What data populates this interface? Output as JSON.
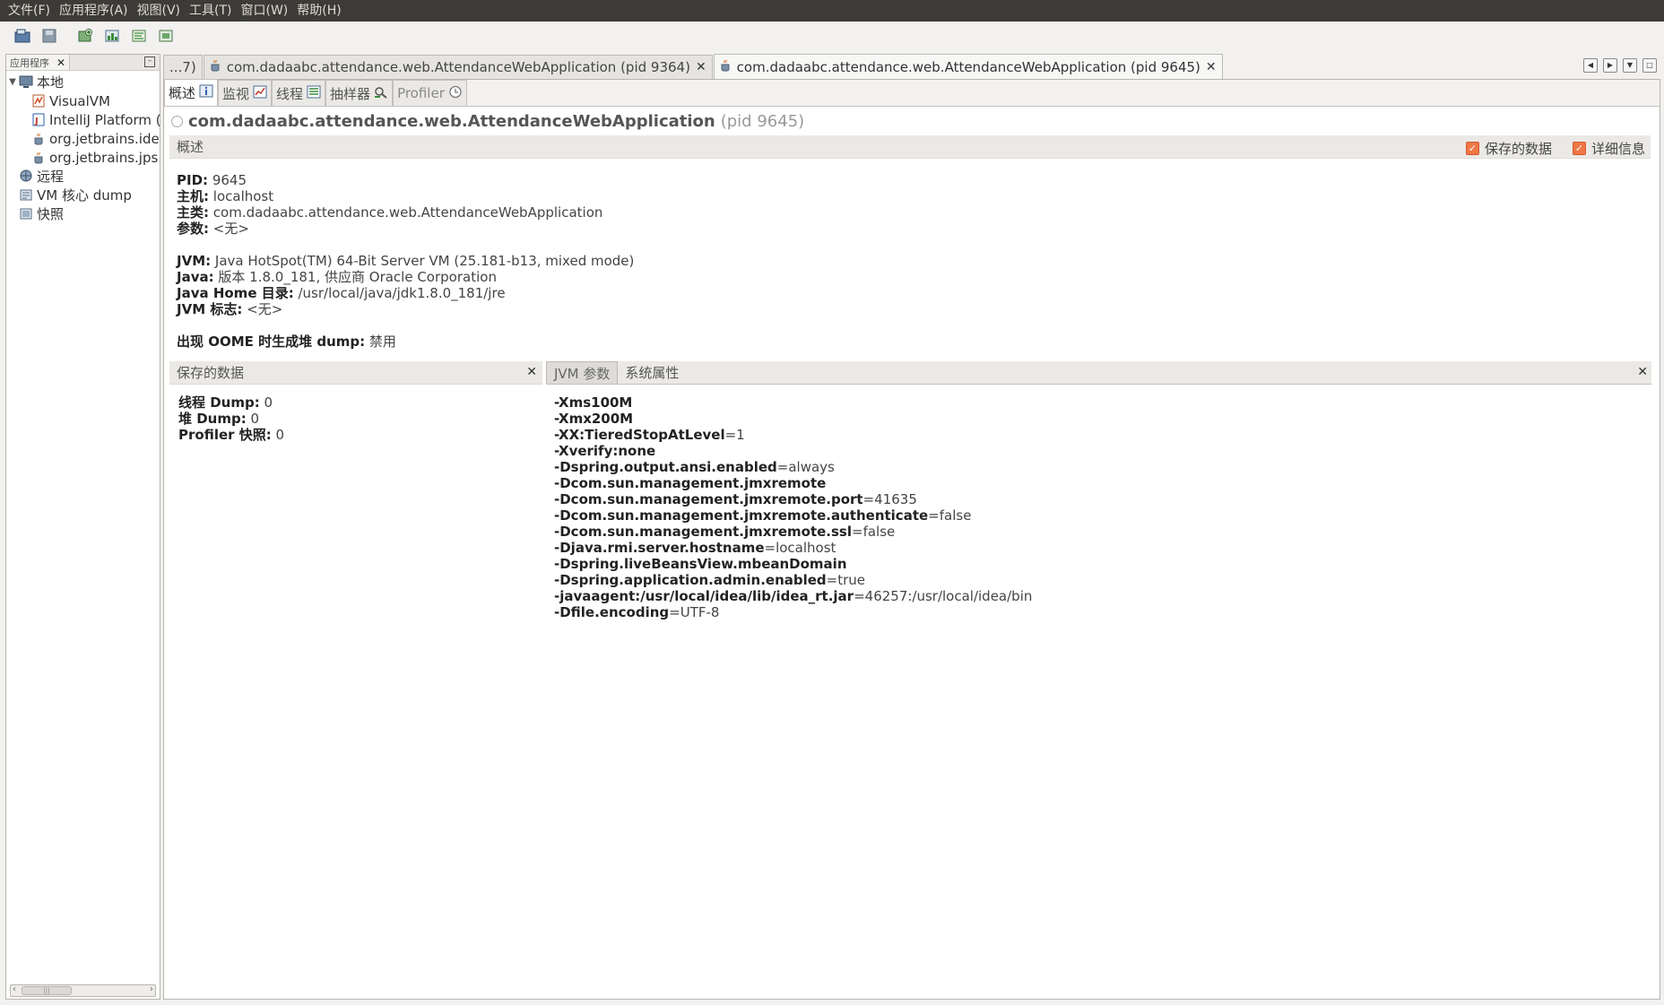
{
  "menubar": {
    "items": [
      "文件(F)",
      "应用程序(A)",
      "视图(V)",
      "工具(T)",
      "窗口(W)",
      "帮助(H)"
    ]
  },
  "toolbar": {
    "buttons": [
      "open-icon",
      "save-icon",
      "add-jmx-icon",
      "heap-dump-icon",
      "thread-dump-icon",
      "snapshot-icon"
    ]
  },
  "left_panel": {
    "tab_label": "应用程序",
    "tree": {
      "local": "本地",
      "local_children": [
        "VisualVM",
        "IntelliJ Platform (",
        "org.jetbrains.idea",
        "org.jetbrains.jps.c"
      ],
      "remote": "远程",
      "vm_core_dump": "VM 核心 dump",
      "snapshots": "快照"
    }
  },
  "doc_tabs": {
    "overflow": "...7)",
    "tab1": "com.dadaabc.attendance.web.AttendanceWebApplication (pid 9364)",
    "tab2": "com.dadaabc.attendance.web.AttendanceWebApplication (pid 9645)"
  },
  "sub_tabs": {
    "overview": "概述",
    "monitor": "监视",
    "threads": "线程",
    "sampler": "抽样器",
    "profiler": "Profiler"
  },
  "app": {
    "title": "com.dadaabc.attendance.web.AttendanceWebApplication",
    "pid_text": "(pid 9645)"
  },
  "overview": {
    "section_title": "概述",
    "saved_data_checkbox": "保存的数据",
    "details_checkbox": "详细信息",
    "pid_label": "PID:",
    "pid_value": "9645",
    "host_label": "主机:",
    "host_value": "localhost",
    "main_class_label": "主类:",
    "main_class_value": "com.dadaabc.attendance.web.AttendanceWebApplication",
    "args_label": "参数:",
    "args_value": "<无>",
    "jvm_label": "JVM:",
    "jvm_value": "Java HotSpot(TM) 64-Bit Server VM (25.181-b13, mixed mode)",
    "java_label": "Java:",
    "java_value": "版本 1.8.0_181, 供应商 Oracle Corporation",
    "java_home_label": "Java Home 目录:",
    "java_home_value": "/usr/local/java/jdk1.8.0_181/jre",
    "jvm_flags_label": "JVM 标志:",
    "jvm_flags_value": "<无>",
    "oome_label": "出现 OOME 时生成堆 dump:",
    "oome_value": "禁用"
  },
  "saved_data": {
    "title": "保存的数据",
    "thread_dump_label": "线程 Dump:",
    "thread_dump_value": "0",
    "heap_dump_label": "堆 Dump:",
    "heap_dump_value": "0",
    "profiler_snapshot_label": "Profiler 快照:",
    "profiler_snapshot_value": "0"
  },
  "jvm_panel": {
    "tab_jvm_args": "JVM 参数",
    "tab_sys_props": "系统属性",
    "args": [
      {
        "key": "-Xms100M",
        "value": ""
      },
      {
        "key": "-Xmx200M",
        "value": ""
      },
      {
        "key": "-XX:TieredStopAtLevel",
        "value": "=1"
      },
      {
        "key": "-Xverify:none",
        "value": ""
      },
      {
        "key": "-Dspring.output.ansi.enabled",
        "value": "=always"
      },
      {
        "key": "-Dcom.sun.management.jmxremote",
        "value": ""
      },
      {
        "key": "-Dcom.sun.management.jmxremote.port",
        "value": "=41635"
      },
      {
        "key": "-Dcom.sun.management.jmxremote.authenticate",
        "value": "=false"
      },
      {
        "key": "-Dcom.sun.management.jmxremote.ssl",
        "value": "=false"
      },
      {
        "key": "-Djava.rmi.server.hostname",
        "value": "=localhost"
      },
      {
        "key": "-Dspring.liveBeansView.mbeanDomain",
        "value": ""
      },
      {
        "key": "-Dspring.application.admin.enabled",
        "value": "=true"
      },
      {
        "key": "-javaagent:/usr/local/idea/lib/idea_rt.jar",
        "value": "=46257:/usr/local/idea/bin"
      },
      {
        "key": "-Dfile.encoding",
        "value": "=UTF-8"
      }
    ]
  },
  "colors": {
    "menubar_bg": "#3c3b37",
    "checkbox_accent": "#f07746",
    "panel_bg": "#f2f1f0"
  }
}
